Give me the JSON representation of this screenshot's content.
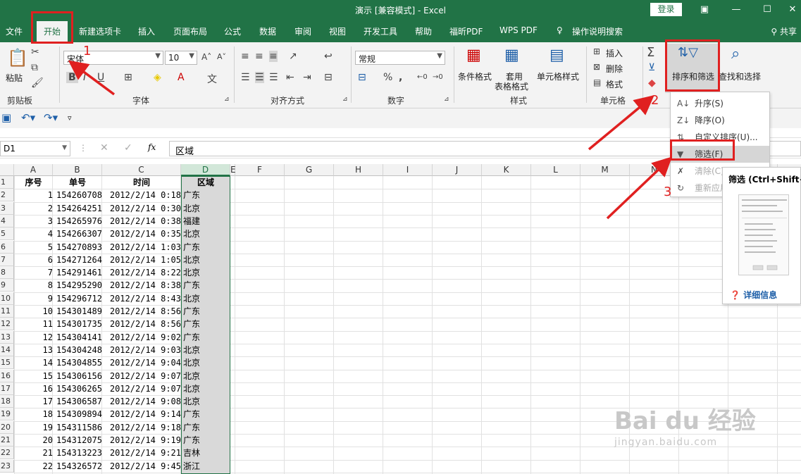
{
  "window": {
    "title": "演示  [兼容模式]  -  Excel",
    "login": "登录"
  },
  "menu_tabs": [
    "文件",
    "开始",
    "新建选项卡",
    "插入",
    "页面布局",
    "公式",
    "数据",
    "审阅",
    "视图",
    "开发工具",
    "帮助",
    "福昕PDF",
    "WPS PDF",
    "操作说明搜索"
  ],
  "share": "共享",
  "ribbon": {
    "clipboard": {
      "paste": "粘贴",
      "label": "剪贴板"
    },
    "font": {
      "name": "宋体",
      "size": "10",
      "label": "字体"
    },
    "alignment": {
      "label": "对齐方式"
    },
    "number": {
      "format": "常规",
      "label": "数字",
      "percent": "%",
      "comma": ","
    },
    "styles": {
      "conditional": "条件格式",
      "table1": "套用",
      "table2": "表格格式",
      "cell_styles": "单元格样式",
      "label": "样式"
    },
    "cells": {
      "insert": "插入",
      "delete": "删除",
      "format": "格式",
      "label": "单元格"
    },
    "editing": {
      "sort_filter": "排序和筛选",
      "find": "查找和选择"
    }
  },
  "namebox": "D1",
  "formula": "区域",
  "fx": "fx",
  "columns": [
    "A",
    "B",
    "C",
    "D",
    "E",
    "F",
    "G",
    "H",
    "I",
    "J",
    "K",
    "L",
    "M",
    "N"
  ],
  "headers": [
    "序号",
    "单号",
    "时间",
    "区域"
  ],
  "rows": [
    [
      "1",
      "154260708",
      "2012/2/14 0:18",
      "广东"
    ],
    [
      "2",
      "154264251",
      "2012/2/14 0:30",
      "北京"
    ],
    [
      "3",
      "154265976",
      "2012/2/14 0:38",
      "福建"
    ],
    [
      "4",
      "154266307",
      "2012/2/14 0:35",
      "北京"
    ],
    [
      "5",
      "154270893",
      "2012/2/14 1:03",
      "广东"
    ],
    [
      "6",
      "154271264",
      "2012/2/14 1:05",
      "北京"
    ],
    [
      "7",
      "154291461",
      "2012/2/14 8:22",
      "北京"
    ],
    [
      "8",
      "154295290",
      "2012/2/14 8:38",
      "广东"
    ],
    [
      "9",
      "154296712",
      "2012/2/14 8:43",
      "北京"
    ],
    [
      "10",
      "154301489",
      "2012/2/14 8:56",
      "广东"
    ],
    [
      "11",
      "154301735",
      "2012/2/14 8:56",
      "广东"
    ],
    [
      "12",
      "154304141",
      "2012/2/14 9:02",
      "广东"
    ],
    [
      "13",
      "154304248",
      "2012/2/14 9:03",
      "北京"
    ],
    [
      "14",
      "154304855",
      "2012/2/14 9:04",
      "北京"
    ],
    [
      "15",
      "154306156",
      "2012/2/14 9:07",
      "北京"
    ],
    [
      "16",
      "154306265",
      "2012/2/14 9:07",
      "北京"
    ],
    [
      "17",
      "154306587",
      "2012/2/14 9:08",
      "北京"
    ],
    [
      "18",
      "154309894",
      "2012/2/14 9:14",
      "广东"
    ],
    [
      "19",
      "154311586",
      "2012/2/14 9:18",
      "广东"
    ],
    [
      "20",
      "154312075",
      "2012/2/14 9:19",
      "广东"
    ],
    [
      "21",
      "154313223",
      "2012/2/14 9:21",
      "吉林"
    ],
    [
      "22",
      "154326572",
      "2012/2/14 9:45",
      "浙江"
    ]
  ],
  "sort_menu": [
    {
      "label": "升序(S)",
      "icon": "sort-asc-icon",
      "state": "normal"
    },
    {
      "label": "降序(O)",
      "icon": "sort-desc-icon",
      "state": "normal"
    },
    {
      "label": "自定义排序(U)...",
      "icon": "custom-sort-icon",
      "state": "normal"
    },
    {
      "label": "筛选(F)",
      "icon": "filter-icon",
      "state": "highlight"
    },
    {
      "label": "清除(C)",
      "icon": "clear-filter-icon",
      "state": "disabled"
    },
    {
      "label": "重新应用",
      "icon": "reapply-icon",
      "state": "disabled"
    }
  ],
  "tooltip": {
    "title": "筛选 (Ctrl+Shift+L)",
    "more": "详细信息"
  },
  "annotations": [
    "1",
    "2",
    "3"
  ],
  "watermark": {
    "main": "Bai du 经验",
    "sub": "jingyan.baidu.com"
  },
  "colors": {
    "excel_green": "#217346",
    "annotation_red": "#e02020",
    "selected_col": "#d9d9d9"
  }
}
